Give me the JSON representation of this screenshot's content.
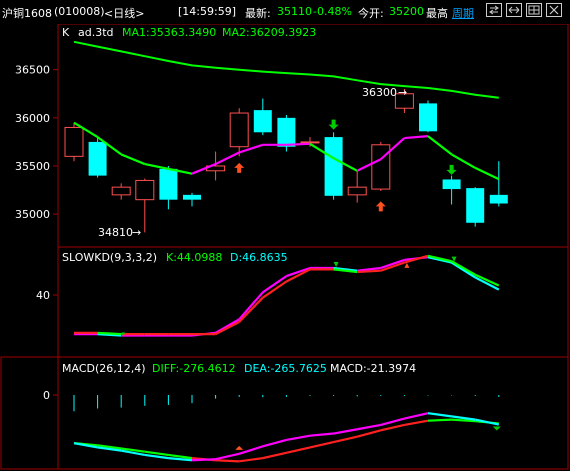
{
  "header": {
    "symbol": "沪铜1608",
    "code": "(010008)",
    "period": "<日线>",
    "time": "[14:59:59]",
    "latest_label": "最新:",
    "latest_value": "35110",
    "change_pct": "-0.48%",
    "open_label": "今开:",
    "open_value": "35200",
    "high_label": "最高",
    "period_link": "周期",
    "icons": [
      "swap-icon",
      "arrows-icon",
      "grid-icon",
      "close-icon"
    ]
  },
  "main_panel": {
    "title_k": "K",
    "title_name": "ad.3td",
    "ma1_label": "MA1:35363.3490",
    "ma2_label": "MA2:36209.3923",
    "y_ticks": [
      "36500",
      "36000",
      "35500",
      "35000"
    ],
    "annotation_low": "34810",
    "annotation_high": "36300"
  },
  "kd_panel": {
    "title": "SLOWKD(9,3,3,2)",
    "k_label": "K:44.0988",
    "d_label": "D:46.8635",
    "y_tick": "40"
  },
  "macd_panel": {
    "title": "MACD(26,12,4)",
    "diff_label": "DIFF:-276.4612",
    "dea_label": "DEA:-265.7625",
    "macd_label": "MACD:-21.3974",
    "y_tick": "0"
  },
  "colors": {
    "up": "#ff5050",
    "down": "#00ffff",
    "ma1": "#ff00ff",
    "ma2": "#00ff00",
    "border": "#a00000",
    "label": "#ffffff",
    "header_time": "#ffffff",
    "latest": "#00ff00"
  },
  "chart_data": {
    "type": "candlestick",
    "candles": [
      {
        "o": 35600,
        "c": 35900,
        "h": 35950,
        "l": 35550
      },
      {
        "o": 35750,
        "c": 35400,
        "h": 35800,
        "l": 35380
      },
      {
        "o": 35200,
        "c": 35280,
        "h": 35320,
        "l": 35150
      },
      {
        "o": 35150,
        "c": 35350,
        "h": 35370,
        "l": 34810
      },
      {
        "o": 35470,
        "c": 35150,
        "h": 35500,
        "l": 35050
      },
      {
        "o": 35200,
        "c": 35150,
        "h": 35220,
        "l": 35080
      },
      {
        "o": 35450,
        "c": 35500,
        "h": 35650,
        "l": 35350
      },
      {
        "o": 35700,
        "c": 36050,
        "h": 36100,
        "l": 35600
      },
      {
        "o": 36080,
        "c": 35850,
        "h": 36200,
        "l": 35820
      },
      {
        "o": 36000,
        "c": 35700,
        "h": 36030,
        "l": 35650
      },
      {
        "o": 35750,
        "c": 35750,
        "h": 35800,
        "l": 35700
      },
      {
        "o": 35800,
        "c": 35190,
        "h": 35850,
        "l": 35150
      },
      {
        "o": 35200,
        "c": 35280,
        "h": 35450,
        "l": 35120
      },
      {
        "o": 35260,
        "c": 35720,
        "h": 35750,
        "l": 35240
      },
      {
        "o": 36100,
        "c": 36250,
        "h": 36300,
        "l": 36050
      },
      {
        "o": 36150,
        "c": 35860,
        "h": 36180,
        "l": 35850
      },
      {
        "o": 35360,
        "c": 35260,
        "h": 35400,
        "l": 35100
      },
      {
        "o": 35270,
        "c": 34910,
        "h": 35280,
        "l": 34870
      },
      {
        "o": 35200,
        "c": 35110,
        "h": 35550,
        "l": 35080
      }
    ],
    "ma1": [
      35950,
      35800,
      35620,
      35520,
      35470,
      35420,
      35520,
      35640,
      35720,
      35720,
      35730,
      35580,
      35450,
      35570,
      35790,
      35810,
      35620,
      35480,
      35363
    ],
    "ma2": [
      36790,
      36740,
      36690,
      36640,
      36590,
      36545,
      36520,
      36500,
      36480,
      36465,
      36450,
      36430,
      36390,
      36350,
      36330,
      36310,
      36280,
      36240,
      36209
    ],
    "kd_k": [
      11,
      11,
      10,
      10,
      10,
      10,
      12,
      22,
      42,
      54,
      60,
      60,
      58,
      60,
      66,
      68,
      64,
      53,
      44
    ],
    "kd_d": [
      12,
      12,
      11,
      11,
      11,
      11,
      11,
      20,
      38,
      50,
      59,
      59,
      57,
      58,
      64,
      69,
      65,
      55,
      47
    ],
    "macd_diff": [
      -450,
      -490,
      -520,
      -560,
      -590,
      -610,
      -600,
      -550,
      -480,
      -420,
      -380,
      -360,
      -320,
      -280,
      -220,
      -170,
      -200,
      -230,
      -276
    ],
    "macd_dea": [
      -450,
      -470,
      -500,
      -530,
      -560,
      -590,
      -610,
      -620,
      -590,
      -540,
      -490,
      -440,
      -390,
      -330,
      -280,
      -240,
      -230,
      -245,
      -266
    ],
    "macd_bars": [
      -180,
      -150,
      -140,
      -120,
      -110,
      -90,
      -40,
      -20,
      -25,
      -20,
      -10,
      -10,
      -15,
      -10,
      -10,
      -5,
      -5,
      -10,
      -21
    ]
  }
}
